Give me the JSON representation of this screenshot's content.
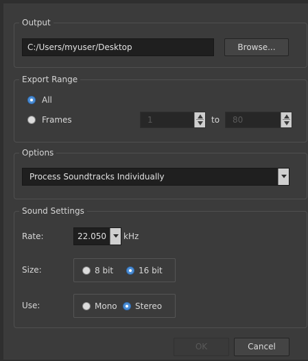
{
  "output": {
    "title": "Output",
    "path": "C:/Users/myuser/Desktop",
    "browse_label": "Browse..."
  },
  "export_range": {
    "title": "Export Range",
    "all_label": "All",
    "frames_label": "Frames",
    "from_value": "1",
    "to_label": "to",
    "to_value": "80",
    "selected": "All"
  },
  "options": {
    "title": "Options",
    "selected": "Process Soundtracks Individually"
  },
  "sound_settings": {
    "title": "Sound Settings",
    "rate_label": "Rate:",
    "rate_value": "22.050",
    "rate_unit": "kHz",
    "size_label": "Size:",
    "size_8_label": "8 bit",
    "size_16_label": "16 bit",
    "size_selected": "16 bit",
    "use_label": "Use:",
    "mono_label": "Mono",
    "stereo_label": "Stereo",
    "use_selected": "Stereo"
  },
  "footer": {
    "ok_label": "OK",
    "cancel_label": "Cancel"
  }
}
